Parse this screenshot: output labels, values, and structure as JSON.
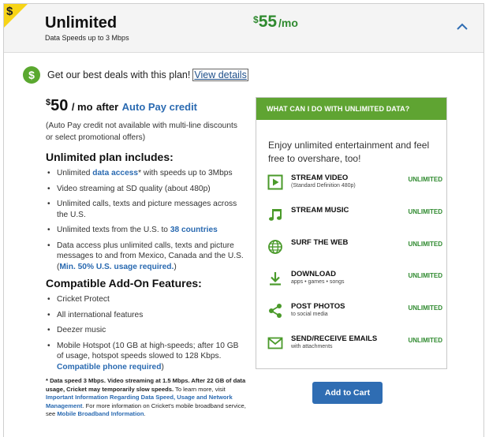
{
  "header": {
    "corner_glyph": "$",
    "plan_name": "Unlimited",
    "plan_subtitle": "Data Speeds up to 3 Mbps",
    "price_symbol": "$",
    "price_amount": "55",
    "price_period": "/mo",
    "collapse_icon": "chevron-up-icon"
  },
  "deal": {
    "icon": "dollar-circle-icon",
    "text": "Get our best deals with this plan!",
    "link": "View details"
  },
  "left": {
    "price_symbol": "$",
    "price_amount": "50",
    "price_period": "/ mo",
    "price_after": "after",
    "autopay_link": "Auto Pay credit",
    "autopay_note": "(Auto Pay credit not available with multi-line discounts or select promotional offers)",
    "includes_heading": "Unlimited plan includes:",
    "includes": {
      "item0_pre": "Unlimited ",
      "item0_link": "data access",
      "item0_sup": "*",
      "item0_post": " with speeds up to 3Mbps",
      "item1": "Video streaming at SD quality (about 480p)",
      "item2": "Unlimited calls, texts and picture messages across the U.S.",
      "item3_pre": "Unlimited texts from the U.S. to ",
      "item3_link": "38 countries",
      "item4_pre": "Data access plus unlimited calls, texts and picture messages to and from Mexico, Canada and the U.S. (",
      "item4_link": "Min. 50% U.S. usage required.",
      "item4_post": ")"
    },
    "addons_heading": "Compatible Add-On Features:",
    "addons": {
      "item0": "Cricket Protect",
      "item1": "All international features",
      "item2": "Deezer music",
      "item3_pre": "Mobile Hotspot (10 GB at high-speeds; after 10 GB of usage, hotspot speeds slowed to 128 Kbps. ",
      "item3_link": "Compatible phone required",
      "item3_post": ")"
    },
    "footnote": {
      "bold": "* Data speed 3 Mbps. Video streaming at 1.5 Mbps. After 22 GB of data usage, Cricket may temporarily slow speeds.",
      "text1": " To learn more, visit ",
      "link1": "Important Information Regarding Data Speed, Usage and Network Management",
      "text2": ". For more information on Cricket's mobile broadband service, see ",
      "link2": "Mobile Broadband Information",
      "text3": "."
    }
  },
  "right": {
    "heading": "WHAT CAN I DO WITH UNLIMITED DATA?",
    "intro": "Enjoy unlimited entertainment and feel free to overshare, too!",
    "features": [
      {
        "title": "STREAM VIDEO",
        "sub": "(Standard Definition 480p)",
        "value": "UNLIMITED",
        "icon": "play-video-icon"
      },
      {
        "title": "STREAM MUSIC",
        "sub": "",
        "value": "UNLIMITED",
        "icon": "music-note-icon"
      },
      {
        "title": "SURF THE WEB",
        "sub": "",
        "value": "UNLIMITED",
        "icon": "globe-icon"
      },
      {
        "title": "DOWNLOAD",
        "sub": "apps • games • songs",
        "value": "UNLIMITED",
        "icon": "download-icon"
      },
      {
        "title": "POST PHOTOS",
        "sub": "to social media",
        "value": "UNLIMITED",
        "icon": "share-icon"
      },
      {
        "title": "SEND/RECEIVE EMAILS",
        "sub": "with attachments",
        "value": "UNLIMITED",
        "icon": "email-icon"
      }
    ]
  },
  "cart": {
    "label": "Add to Cart"
  },
  "colors": {
    "green": "#5fa432",
    "price_green": "#2f8a2f",
    "link_blue": "#2a6ab1",
    "button_blue": "#2f6db3",
    "badge_yellow": "#f7d417"
  }
}
